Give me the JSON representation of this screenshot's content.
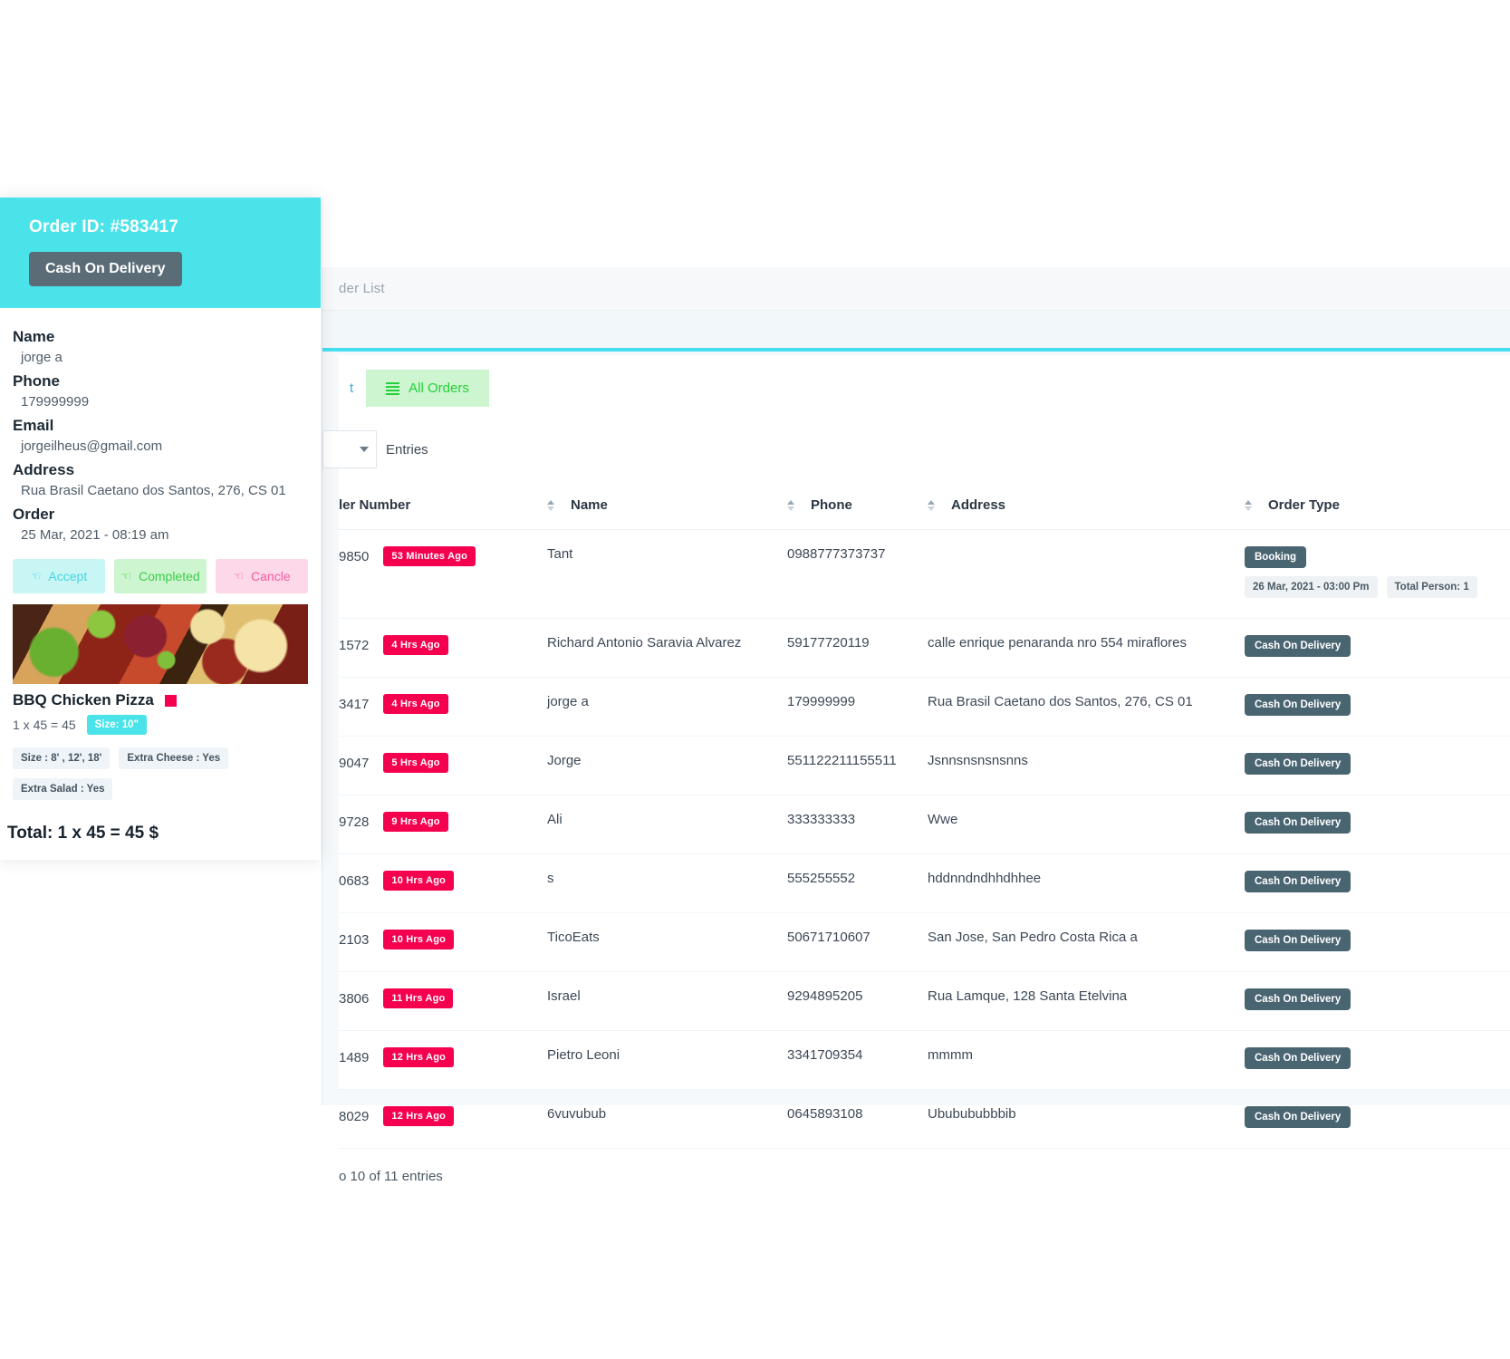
{
  "admin": {
    "breadcrumb": "der List",
    "partial_tab_label": "t",
    "all_orders_button": "All Orders",
    "entries_label": "Entries",
    "entries_value": "",
    "footer": "o 10 of 11 entries",
    "columns": [
      "ler Number",
      "Name",
      "Phone",
      "Address",
      "Order Type"
    ],
    "rows": [
      {
        "number": "9850",
        "time": "53 Minutes Ago",
        "name": "Tant",
        "phone": "0988777373737",
        "address": "",
        "type": "Booking",
        "booking_time": "26 Mar, 2021 - 03:00 Pm",
        "total_person": "Total Person: 1"
      },
      {
        "number": "1572",
        "time": "4 Hrs Ago",
        "name": "Richard Antonio Saravia Alvarez",
        "phone": "59177720119",
        "address": "calle enrique penaranda nro 554 miraflores",
        "type": "Cash On Delivery"
      },
      {
        "number": "3417",
        "time": "4 Hrs Ago",
        "name": "jorge a",
        "phone": "179999999",
        "address": "Rua Brasil Caetano dos Santos, 276, CS 01",
        "type": "Cash On Delivery"
      },
      {
        "number": "9047",
        "time": "5 Hrs Ago",
        "name": "Jorge",
        "phone": "551122211155511",
        "address": "Jsnnsnsnsnsnns",
        "type": "Cash On Delivery"
      },
      {
        "number": "9728",
        "time": "9 Hrs Ago",
        "name": "Ali",
        "phone": "333333333",
        "address": "Wwe",
        "type": "Cash On Delivery"
      },
      {
        "number": "0683",
        "time": "10 Hrs Ago",
        "name": "s",
        "phone": "555255552",
        "address": "hddnndndhhdhhee",
        "type": "Cash On Delivery"
      },
      {
        "number": "2103",
        "time": "10 Hrs Ago",
        "name": "TicoEats",
        "phone": "50671710607",
        "address": "San Jose, San Pedro Costa Rica a",
        "type": "Cash On Delivery"
      },
      {
        "number": "3806",
        "time": "11 Hrs Ago",
        "name": "Israel",
        "phone": "9294895205",
        "address": "Rua Lamque, 128 Santa Etelvina",
        "type": "Cash On Delivery"
      },
      {
        "number": "1489",
        "time": "12 Hrs Ago",
        "name": "Pietro Leoni",
        "phone": "3341709354",
        "address": "mmmm",
        "type": "Cash On Delivery"
      },
      {
        "number": "8029",
        "time": "12 Hrs Ago",
        "name": "6vuvubub",
        "phone": "0645893108",
        "address": "Ububububbbib",
        "type": "Cash On Delivery"
      }
    ]
  },
  "detail": {
    "order_id": "Order ID: #583417",
    "payment_badge": "Cash On Delivery",
    "labels": {
      "name": "Name",
      "phone": "Phone",
      "email": "Email",
      "address": "Address",
      "order": "Order"
    },
    "values": {
      "name": "jorge a",
      "phone": "179999999",
      "email": "jorgeilheus@gmail.com",
      "address": "Rua Brasil Caetano dos Santos, 276, CS 01",
      "order_date": "25 Mar, 2021 - 08:19 am"
    },
    "actions": {
      "accept": "Accept",
      "completed": "Completed",
      "cancel": "Cancle"
    },
    "item": {
      "title": "BBQ Chicken Pizza",
      "price_line": "1 x 45 = 45",
      "size_badge": "Size: 10\"",
      "addons": [
        "Size : 8' , 12', 18'",
        "Extra Cheese : Yes",
        "Extra Salad : Yes"
      ]
    },
    "total": "Total: 1 x 45 = 45 $"
  },
  "colors": {
    "accent_cyan": "#4ae3ea",
    "badge_pink": "#f5004f",
    "badge_slate": "#4a6572",
    "green_soft": "#cdf5cf",
    "green_text": "#24d13a"
  }
}
